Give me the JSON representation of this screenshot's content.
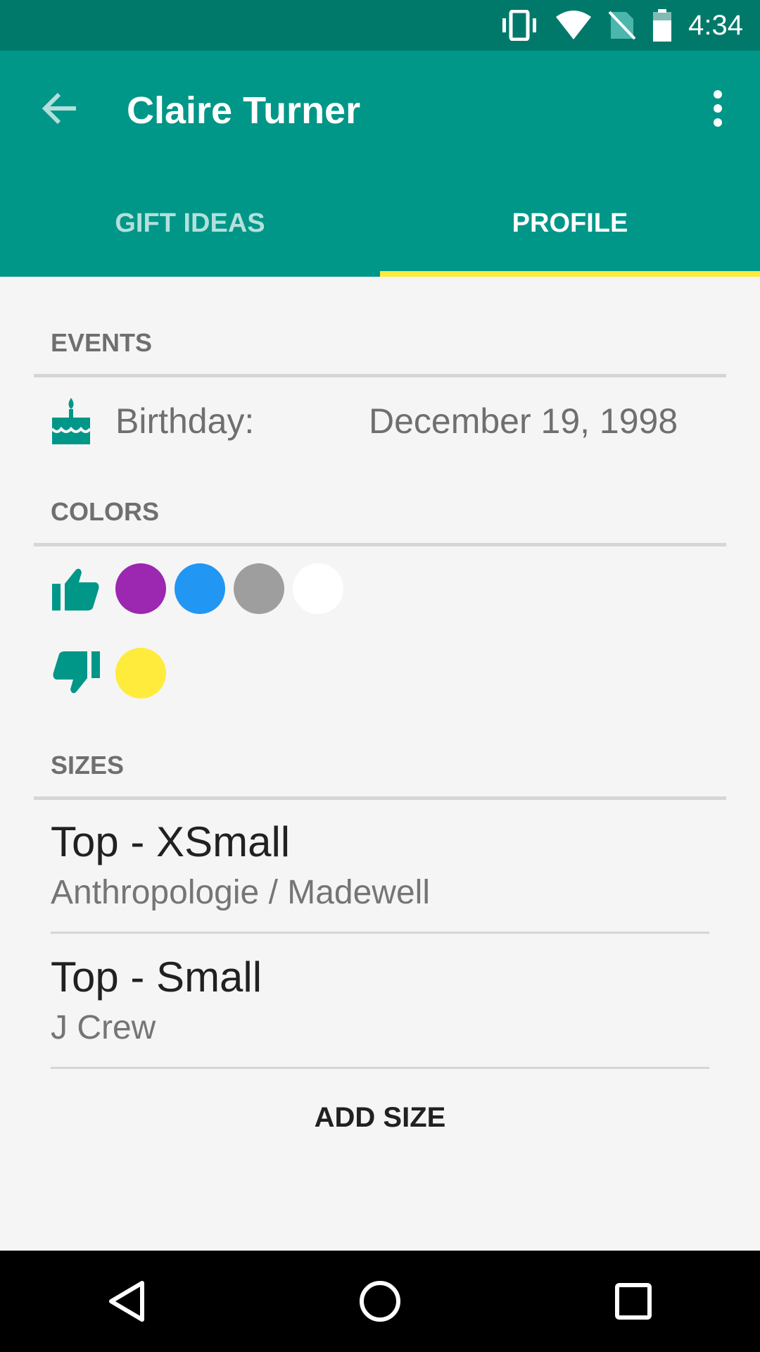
{
  "status_bar": {
    "time": "4:34",
    "icons": [
      "vibrate-icon",
      "wifi-icon",
      "no-sim-icon",
      "battery-icon"
    ]
  },
  "app_bar": {
    "title": "Claire Turner"
  },
  "tabs": [
    {
      "label": "GIFT IDEAS",
      "active": false
    },
    {
      "label": "PROFILE",
      "active": true
    }
  ],
  "events": {
    "header": "EVENTS",
    "items": [
      {
        "icon": "cake-icon",
        "label": "Birthday:",
        "value": "December 19, 1998"
      }
    ]
  },
  "colors": {
    "header": "COLORS",
    "likes": [
      "#9c27b0",
      "#2196f3",
      "#9e9e9e",
      "#ffffff"
    ],
    "dislikes": [
      "#ffeb3b"
    ]
  },
  "sizes": {
    "header": "SIZES",
    "items": [
      {
        "title": "Top - XSmall",
        "subtitle": "Anthropologie / Madewell"
      },
      {
        "title": "Top - Small",
        "subtitle": "J Crew"
      }
    ],
    "add_label": "ADD SIZE"
  },
  "theme": {
    "primary": "#009688",
    "primary_dark": "#00796b",
    "accent": "#ffeb3b"
  }
}
